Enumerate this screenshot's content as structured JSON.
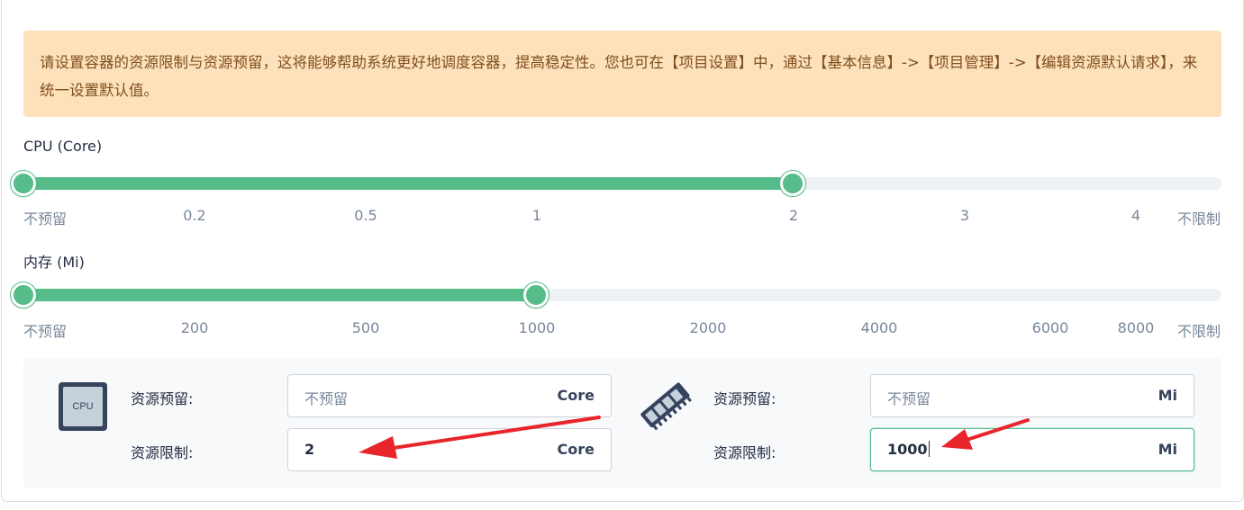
{
  "notice": {
    "text": "请设置容器的资源限制与资源预留，这将能够帮助系统更好地调度容器，提高稳定性。您也可在【项目设置】中，通过【基本信息】->【项目管理】->【编辑资源默认请求】，来统一设置默认值。"
  },
  "cpu_slider": {
    "label": "CPU (Core)",
    "ticks": [
      "不预留",
      "0.2",
      "0.5",
      "1",
      "2",
      "3",
      "4",
      "不限制"
    ],
    "request": "不预留",
    "limit": "2"
  },
  "memory_slider": {
    "label": "内存 (Mi)",
    "ticks": [
      "不预留",
      "200",
      "500",
      "1000",
      "2000",
      "4000",
      "6000",
      "8000",
      "不限制"
    ],
    "request": "不预留",
    "limit": "1000"
  },
  "cpu_form": {
    "icon_text": "CPU",
    "request_label": "资源预留:",
    "request_placeholder": "不预留",
    "request_unit": "Core",
    "limit_label": "资源限制:",
    "limit_value": "2",
    "limit_unit": "Core"
  },
  "memory_form": {
    "request_label": "资源预留:",
    "request_placeholder": "不预留",
    "request_unit": "Mi",
    "limit_label": "资源限制:",
    "limit_value": "1000",
    "limit_unit": "Mi"
  },
  "colors": {
    "accent": "#55bc8a",
    "notice_bg": "#fde1bb",
    "notice_text": "#7f4f1e",
    "arrow": "#e8252b"
  }
}
